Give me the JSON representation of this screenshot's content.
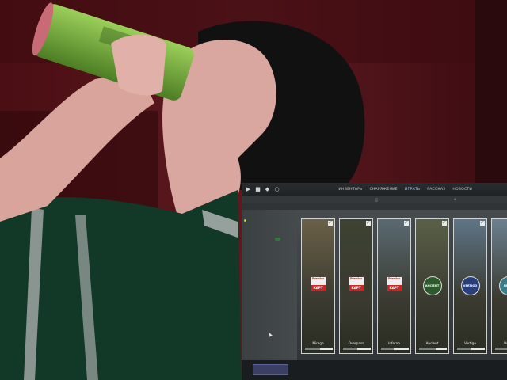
{
  "game_ui": {
    "nav": [
      "ИНВЕНТАРЬ",
      "СНАРЯЖЕНИЕ",
      "ИГРАТЬ",
      "РАССКАЗ",
      "НОВОСТИ"
    ],
    "active_nav_index": 2,
    "subtabs": [
      "",
      "",
      "",
      "",
      ""
    ],
    "filters": [
      "",
      "",
      "",
      ""
    ],
    "left_panel": {
      "title_lines": [
        "",
        ""
      ],
      "label": "",
      "option": ""
    },
    "maps": [
      {
        "name": "Mirage",
        "logo": "premier",
        "progress": 0.55,
        "bg": "#6b6048"
      },
      {
        "name": "Overpass",
        "logo": "premier",
        "progress": 0.5,
        "bg": "#3d4232"
      },
      {
        "name": "Inferno",
        "logo": "premier",
        "progress": 0.45,
        "bg": "#5a6a72"
      },
      {
        "name": "Ancient",
        "logo": "emblem",
        "progress": 0.6,
        "bg": "#5a6048"
      },
      {
        "name": "Vertigo",
        "logo": "emblem",
        "progress": 0.5,
        "bg": "#5f7587"
      },
      {
        "name": "Nuke",
        "logo": "emblem",
        "progress": 0.5,
        "bg": "#6c8090"
      }
    ],
    "premier_logo": {
      "top": "Premier",
      "bottom": "КАРТ"
    },
    "emblems": [
      "ANCIENT",
      "VERTIGO",
      "NUKE"
    ],
    "bottom_button": {
      "line1": "",
      "line2": ""
    }
  },
  "colors": {
    "accent": "#9fd3ff",
    "background": "#3a0f14"
  }
}
